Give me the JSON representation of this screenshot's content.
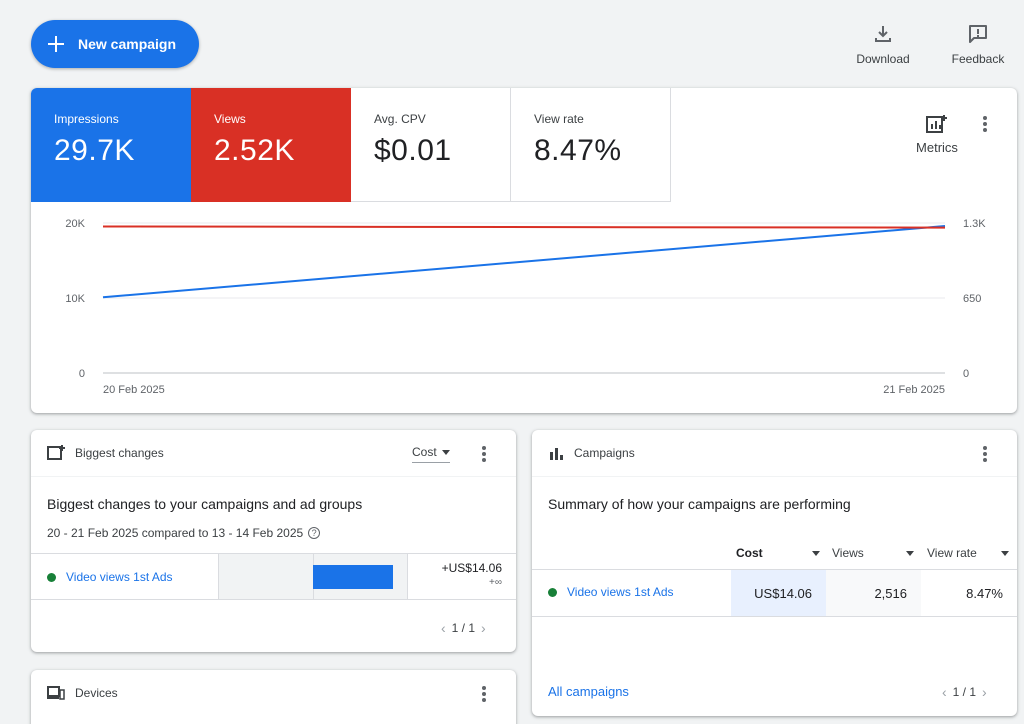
{
  "toolbar": {
    "new_campaign_label": "New campaign",
    "download_label": "Download",
    "feedback_label": "Feedback"
  },
  "scorecards": [
    {
      "label": "Impressions",
      "value": "29.7K",
      "color": "#1a73e8"
    },
    {
      "label": "Views",
      "value": "2.52K",
      "color": "#d93025"
    },
    {
      "label": "Avg. CPV",
      "value": "$0.01"
    },
    {
      "label": "View rate",
      "value": "8.47%"
    }
  ],
  "metrics_label": "Metrics",
  "chart_data": {
    "type": "line",
    "x": [
      "20 Feb 2025",
      "21 Feb 2025"
    ],
    "left_axis": {
      "ticks": [
        "0",
        "10K",
        "20K"
      ],
      "ylim": [
        0,
        20000
      ]
    },
    "right_axis": {
      "ticks": [
        "0",
        "650",
        "1.3K"
      ],
      "ylim": [
        0,
        1300
      ]
    },
    "series": [
      {
        "name": "Impressions",
        "axis": "left",
        "values": [
          10100,
          19600
        ],
        "color": "#1a73e8"
      },
      {
        "name": "Views",
        "axis": "right",
        "values": [
          1270,
          1260
        ],
        "color": "#d93025"
      }
    ],
    "grid": true
  },
  "biggest_changes": {
    "header": "Biggest changes",
    "sort_label": "Cost",
    "title": "Biggest changes to your campaigns and ad groups",
    "subtitle": "20 - 21 Feb 2025 compared to 13 - 14 Feb 2025",
    "help_glyph": "?",
    "row": {
      "campaign": "Video views 1st Ads",
      "change": "+US$14.06",
      "change_pct": "+∞"
    },
    "pager": "1 / 1"
  },
  "campaigns": {
    "header": "Campaigns",
    "title": "Summary of how your campaigns are performing",
    "columns": [
      "Cost",
      "Views",
      "View rate"
    ],
    "rows": [
      {
        "name": "Video views 1st Ads",
        "cost": "US$14.06",
        "views": "2,516",
        "view_rate": "8.47%"
      }
    ],
    "all_link": "All campaigns",
    "pager": "1 / 1"
  },
  "devices": {
    "header": "Devices"
  }
}
